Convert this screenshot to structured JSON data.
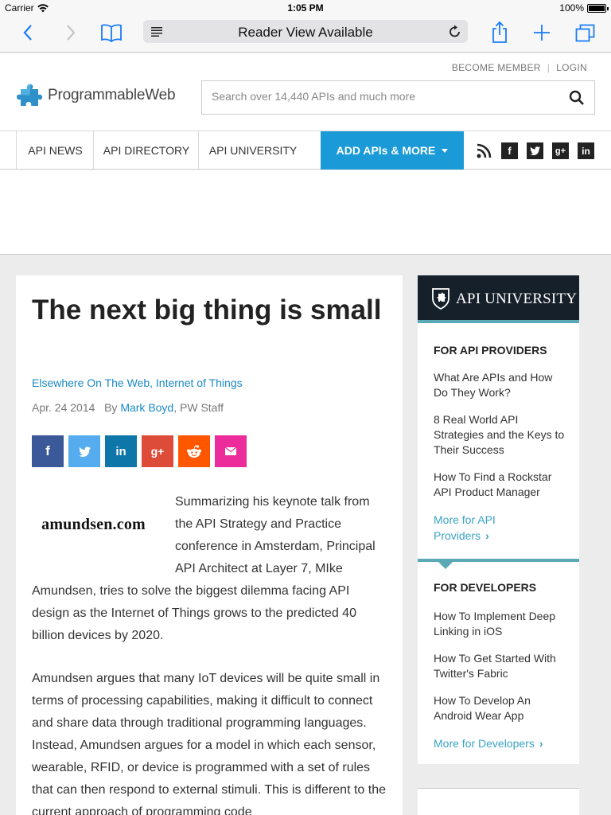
{
  "status": {
    "carrier": "Carrier",
    "time": "1:05 PM",
    "battery": "100%"
  },
  "browser": {
    "address_text": "Reader View Available"
  },
  "site": {
    "logo_text": "ProgrammableWeb",
    "become_member": "BECOME MEMBER",
    "login": "LOGIN",
    "search_placeholder": "Search over 14,440 APIs and much more"
  },
  "nav": {
    "items": [
      "API NEWS",
      "API DIRECTORY",
      "API UNIVERSITY"
    ],
    "add_label": "ADD APIs & MORE",
    "accent": "#1a9ad6"
  },
  "article": {
    "title": "The next big thing is small",
    "category1": "Elsewhere On The Web",
    "category_sep": ", ",
    "category2": "Internet of Things",
    "date": "Apr. 24 2014",
    "by": "By",
    "author": "Mark Boyd",
    "author_suffix": ", PW Staff",
    "image_text": "amundsen.com",
    "share_colors": [
      "#3b5998",
      "#55acee",
      "#0e76a8",
      "#dd4b39",
      "#ff5700",
      "#ec2c9b"
    ],
    "p1": "Summarizing his keynote talk from the API Strategy and Practice conference in Amsterdam, Principal API Architect at Layer 7, MIke Amundsen, tries to solve the biggest dilemma facing API design as the Internet of Things grows to the predicted 40 billion devices by 2020.",
    "p2": "Amundsen argues that many IoT devices will be quite small in terms of processing capabilities, making it difficult to connect and share data through traditional programming languages. Instead, Amundsen argues for a model in which each sensor, wearable, RFID, or device is programmed with a set of rules that can then respond to external stimuli. This is different to the current approach of programming code"
  },
  "sidebar": {
    "header": "API UNIVERSITY",
    "providers": {
      "heading": "FOR API PROVIDERS",
      "links": [
        "What Are APIs and How Do They Work?",
        "8 Real World API Strategies and the Keys to Their Success",
        "How To Find a Rockstar API Product Manager"
      ],
      "more": "More for API Providers",
      "chevron": "›"
    },
    "developers": {
      "heading": "FOR DEVELOPERS",
      "links": [
        "How To Implement Deep Linking in iOS",
        "How To Get Started With Twitter's Fabric",
        "How To Develop An Android Wear App"
      ],
      "more": "More for Developers",
      "chevron": "›"
    }
  }
}
